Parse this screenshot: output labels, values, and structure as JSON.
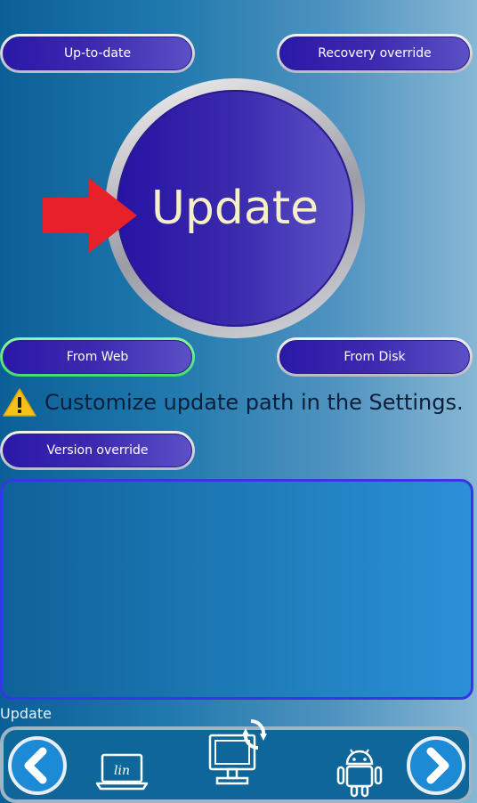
{
  "buttons": {
    "up_to_date": "Up-to-date",
    "recovery_override": "Recovery override",
    "from_web": "From Web",
    "from_disk": "From Disk",
    "version_override": "Version override"
  },
  "main_action": {
    "label": "Update"
  },
  "warning": {
    "icon": "warning-icon",
    "text": "Customize update path in the Settings."
  },
  "log_panel": {
    "content": ""
  },
  "status": {
    "label": "Update"
  },
  "bottom_bar": {
    "icons": [
      "chevron-left-icon",
      "laptop-icon",
      "pc-sync-icon",
      "android-icon",
      "chevron-right-icon"
    ],
    "laptop_glyph": "lin"
  },
  "colors": {
    "button_fill": "#3c2bb0",
    "active_glow": "#3fe06a",
    "arrow": "#e8202a",
    "label_text": "#f5f0c8"
  }
}
